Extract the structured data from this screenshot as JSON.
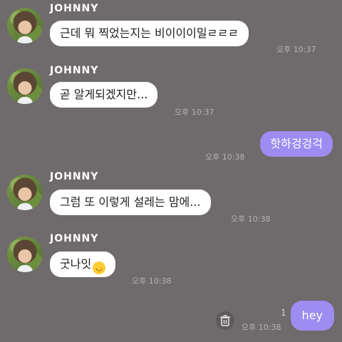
{
  "sender_name": "JOHNNY",
  "messages": [
    {
      "text": "근데 뭐 찍었는지는 비이이이밀ㄹㄹㄹ",
      "time": "오후 10:37"
    },
    {
      "text": "곧 알게되겠지만...",
      "time": "오후 10:37"
    },
    {
      "text": "핫하겅겅걱",
      "time": "오후 10:38",
      "mine": true
    },
    {
      "text": "그럼 또 이렇게 설레는 맘에...",
      "time": "오후 10:38"
    },
    {
      "text": "굿나잇",
      "emoji": "wink-smile-emoji",
      "time": "오후 10:38"
    },
    {
      "text": "hey",
      "time": "오후 10:38",
      "mine": true,
      "unread_count": "1"
    }
  ],
  "colors": {
    "background": "#6f6a6b",
    "my_bubble": "#9d8cf2",
    "their_bubble": "#ffffff"
  },
  "icons": {
    "trash": "trash-icon"
  }
}
